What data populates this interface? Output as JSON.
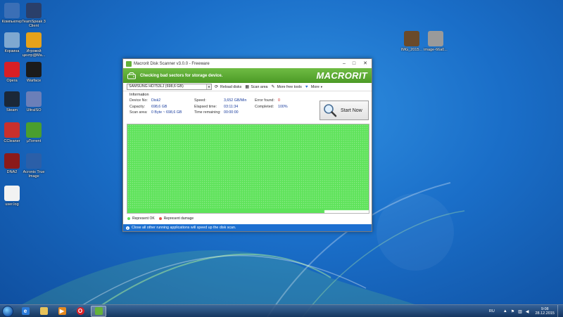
{
  "desktop": {
    "icons_left": [
      {
        "label": "Компьютер",
        "icon": "computer-icon",
        "color": "#3b6fb6"
      },
      {
        "label": "TeamSpeak 3 Client",
        "icon": "teamspeak-icon",
        "color": "#2a3f6a"
      },
      {
        "label": "Корзина",
        "icon": "recycle-bin-icon",
        "color": "#7fa8d0"
      },
      {
        "label": "Игровой центр@Ma...",
        "icon": "game-center-icon",
        "color": "#e6a21a"
      },
      {
        "label": "Opera",
        "icon": "opera-icon",
        "color": "#d81f26"
      },
      {
        "label": "Warface",
        "icon": "warface-icon",
        "color": "#1b1b1b"
      },
      {
        "label": "Steam",
        "icon": "steam-icon",
        "color": "#1b2838"
      },
      {
        "label": "UltraISO",
        "icon": "ultraiso-icon",
        "color": "#6b7fb8"
      },
      {
        "label": "CCleaner",
        "icon": "ccleaner-icon",
        "color": "#c9302c"
      },
      {
        "label": "µTorrent",
        "icon": "utorrent-icon",
        "color": "#4a9e2e"
      },
      {
        "label": "DNA2",
        "icon": "dota-icon",
        "color": "#8b1a1a"
      },
      {
        "label": "Acronis True Image",
        "icon": "acronis-icon",
        "color": "#2b5fa8"
      },
      {
        "label": "user.log",
        "icon": "text-file-icon",
        "color": "#f2f2f2"
      }
    ],
    "icons_right": [
      {
        "label": "IMG_2015...",
        "icon": "image-file-icon",
        "color": "#6a4a2a"
      },
      {
        "label": "image-66a0...",
        "icon": "image-file-icon",
        "color": "#9a9a9a"
      }
    ]
  },
  "window": {
    "title": "Macrorit Disk Scanner v3.0.0 - Freeware",
    "controls": {
      "minimize": "–",
      "maximize": "□",
      "close": "✕"
    },
    "banner": {
      "text": "Checking bad sectors for storage device.",
      "brand": "MACRORIT"
    },
    "toolbar": {
      "device": "SAMSUNG HD753LJ   (698,6 GB)",
      "reload": "Reload disks",
      "scan_area": "Scan area",
      "more_tools": "More free tools",
      "more": "More"
    },
    "info": {
      "heading": "Information",
      "device_no_label": "Device No:",
      "device_no": "Disk2",
      "capacity_label": "Capacity:",
      "capacity": "698,6 GB",
      "scan_area_label": "Scan area:",
      "scan_area": "0 Byte ~ 698,6 GB",
      "speed_label": "Speed:",
      "speed": "3,652 GB/Min",
      "elapsed_label": "Elapsed time:",
      "elapsed": "03:11:34",
      "remaining_label": "Time remaining:",
      "remaining": "00:00:00",
      "error_label": "Error found:",
      "error": "0",
      "completed_label": "Completed:",
      "completed": "100%"
    },
    "start_button": "Start Now",
    "legend": {
      "ok": "Represent OK",
      "damage": "Represent damage"
    },
    "status": "Close all other running applications will speed up the disk scan.",
    "colors": {
      "ok": "#5ee35a",
      "damage": "#e0524a",
      "accent": "#64b23a",
      "status": "#1c6fd0"
    }
  },
  "taskbar": {
    "lang": "RU",
    "time": "9:08",
    "date": "28.12.2015"
  }
}
